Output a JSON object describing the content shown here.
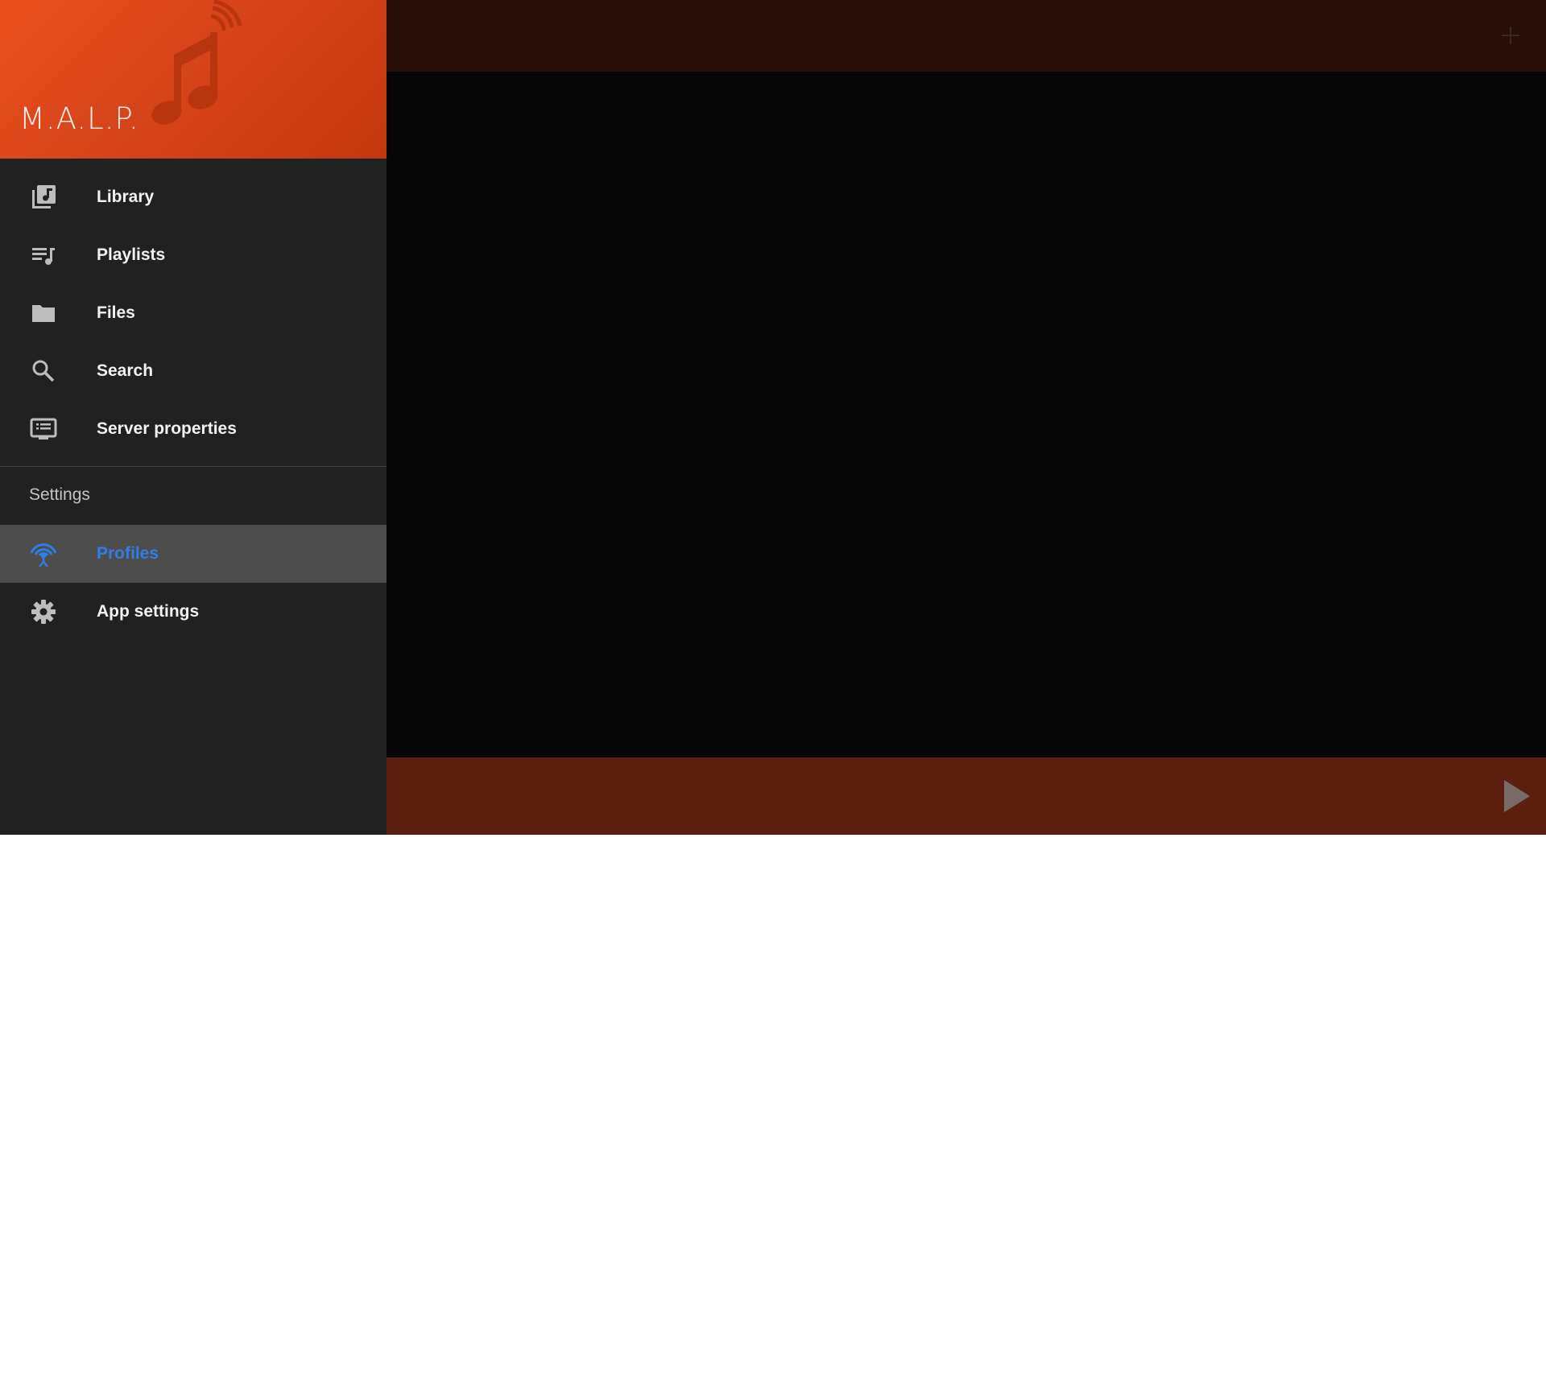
{
  "app": {
    "title": "M.A.L.P."
  },
  "drawer": {
    "items": [
      {
        "label": "Library",
        "icon": "library-music-icon"
      },
      {
        "label": "Playlists",
        "icon": "queue-music-icon"
      },
      {
        "label": "Files",
        "icon": "folder-icon"
      },
      {
        "label": "Search",
        "icon": "search-icon"
      },
      {
        "label": "Server properties",
        "icon": "server-properties-icon"
      }
    ],
    "settings_header": "Settings",
    "settings_items": [
      {
        "label": "Profiles",
        "icon": "profiles-antenna-icon",
        "selected": true
      },
      {
        "label": "App settings",
        "icon": "gear-icon"
      }
    ]
  },
  "toolbar": {
    "add_icon": "add-icon"
  },
  "playbar": {
    "play_icon": "play-icon"
  },
  "colors": {
    "header_accent": "#e9501f",
    "selected_text": "#2f7fe6",
    "drawer_bg": "#212121",
    "topbar_bg": "#280f08",
    "bottombar_bg": "#5c1f0e"
  }
}
